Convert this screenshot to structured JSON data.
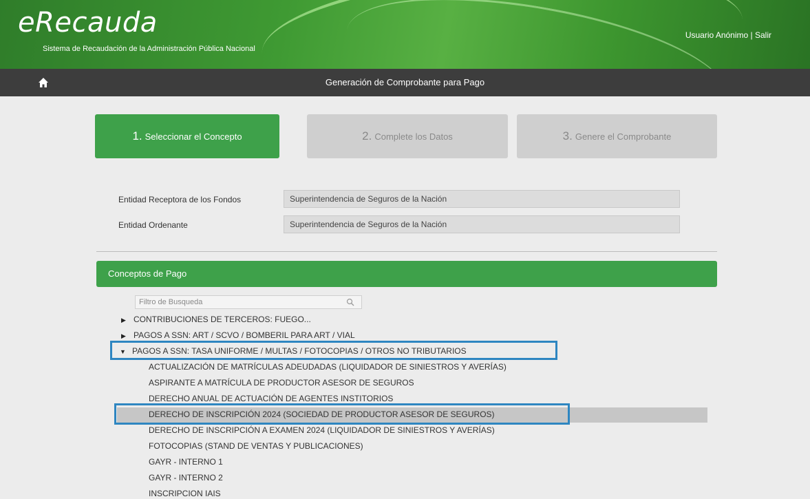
{
  "header": {
    "logo_text": "eRecauda",
    "subtitle": "Sistema de Recaudación de la Administración Pública Nacional",
    "user_link": "Usuario Anónimo | Salir"
  },
  "navbar": {
    "title": "Generación de Comprobante para Pago",
    "home_icon": "home-icon"
  },
  "steps": [
    {
      "num": "1.",
      "label": "Seleccionar el Concepto",
      "state": "active"
    },
    {
      "num": "2.",
      "label": "Complete los Datos",
      "state": "inactive"
    },
    {
      "num": "3.",
      "label": "Genere el Comprobante",
      "state": "inactive"
    }
  ],
  "form": {
    "receptora_label": "Entidad Receptora de los Fondos",
    "receptora_value": "Superintendencia de Seguros de la Nación",
    "ordenante_label": "Entidad Ordenante",
    "ordenante_value": "Superintendencia de Seguros de la Nación"
  },
  "conceptos": {
    "header": "Conceptos de Pago",
    "search_placeholder": "Filtro de Busqueda",
    "tree": [
      {
        "label": "CONTRIBUCIONES DE TERCEROS: FUEGO...",
        "expanded": false
      },
      {
        "label": "PAGOS A SSN: ART / SCVO / BOMBERIL PARA ART / VIAL",
        "expanded": false
      },
      {
        "label": "PAGOS A SSN: TASA UNIFORME / MULTAS / FOTOCOPIAS / OTROS NO TRIBUTARIOS",
        "expanded": true
      }
    ],
    "children": [
      "ACTUALIZACIÓN DE MATRÍCULAS ADEUDADAS (LIQUIDADOR DE SINIESTROS Y AVERÍAS)",
      "ASPIRANTE A MATRÍCULA DE PRODUCTOR ASESOR DE SEGUROS",
      "DERECHO ANUAL DE ACTUACIÓN DE AGENTES INSTITORIOS",
      "DERECHO DE INSCRIPCIÓN 2024 (SOCIEDAD DE PRODUCTOR ASESOR DE SEGUROS)",
      "DERECHO DE INSCRIPCIÓN A EXAMEN 2024 (LIQUIDADOR DE SINIESTROS Y AVERÍAS)",
      "FOTOCOPIAS (STAND DE VENTAS Y PUBLICACIONES)",
      "GAYR - INTERNO 1",
      "GAYR - INTERNO 2",
      "INSCRIPCION IAIS"
    ],
    "selected_index": 3
  },
  "colors": {
    "brand_green": "#3ea14a",
    "navbar": "#3d3d3d",
    "highlight_blue": "#2e86c1"
  }
}
